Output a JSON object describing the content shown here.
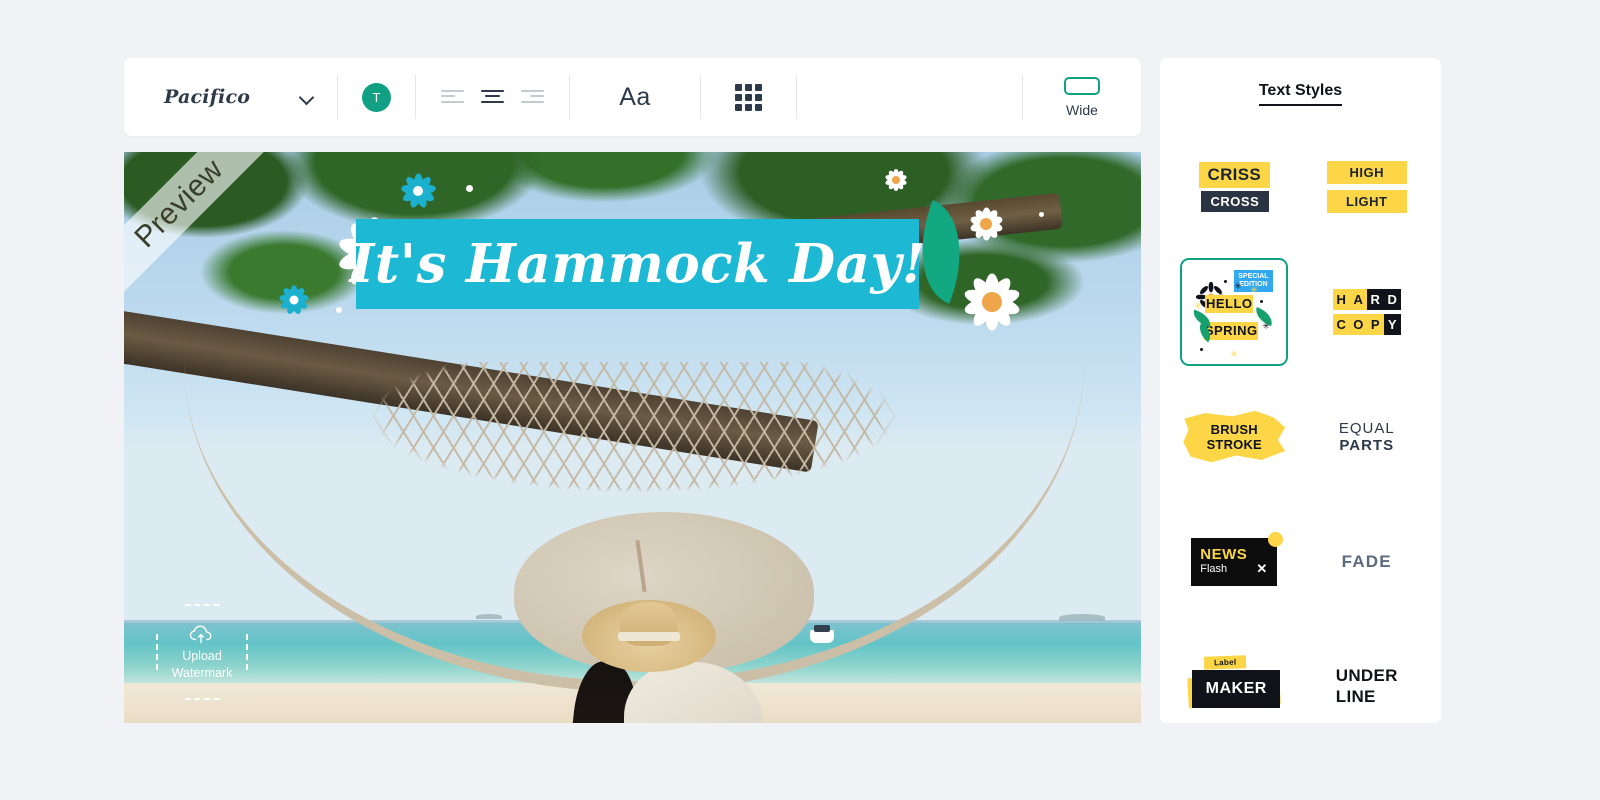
{
  "toolbar": {
    "font_name": "Pacifico",
    "dropdown_icon": "chevron-down-icon",
    "color_swatch_label": "T",
    "color_swatch_hex": "#12a085",
    "align_left": "align-left-icon",
    "align_center": "align-center-icon",
    "align_right": "align-right-icon",
    "case_label": "Aa",
    "grid_icon": "grid-icon",
    "wide_label": "Wide",
    "wide_accent_hex": "#12a085"
  },
  "canvas": {
    "ribbon_label": "Preview",
    "title_text": "It's Hammock Day!",
    "title_band_hex": "#1cb8d4",
    "watermark": {
      "icon": "cloud-upload-icon",
      "line1": "Upload",
      "line2": "Watermark"
    }
  },
  "panel": {
    "title": "Text Styles",
    "styles": [
      {
        "id": "criss-cross",
        "line1": "CRISS",
        "line2": "CROSS",
        "selected": false
      },
      {
        "id": "high-light",
        "line1": "HIGH",
        "line2": "LIGHT",
        "selected": false
      },
      {
        "id": "hello-spring",
        "badge1": "SPECIAL",
        "badge2": "EDITION",
        "line1": "HELLO",
        "line2": "SPRING",
        "selected": true
      },
      {
        "id": "hard-copy",
        "line1": "HARD",
        "line2": "COPY",
        "selected": false
      },
      {
        "id": "brush-stroke",
        "line1": "BRUSH",
        "line2": "STROKE",
        "selected": false
      },
      {
        "id": "equal-parts",
        "line1": "EQUAL",
        "line2": "PARTS",
        "selected": false
      },
      {
        "id": "news-flash",
        "line1": "NEWS",
        "line2": "Flash",
        "close_icon": "✕",
        "selected": false
      },
      {
        "id": "fade",
        "line1": "FADE",
        "selected": false
      },
      {
        "id": "label-maker",
        "line1": "Label",
        "line2": "MAKER",
        "selected": false
      },
      {
        "id": "under-line",
        "line1": "UNDER",
        "line2": "LINE",
        "selected": false
      }
    ],
    "accent_yellow": "#fcd647",
    "accent_dark": "#10131a",
    "selected_border_hex": "#12a085"
  }
}
